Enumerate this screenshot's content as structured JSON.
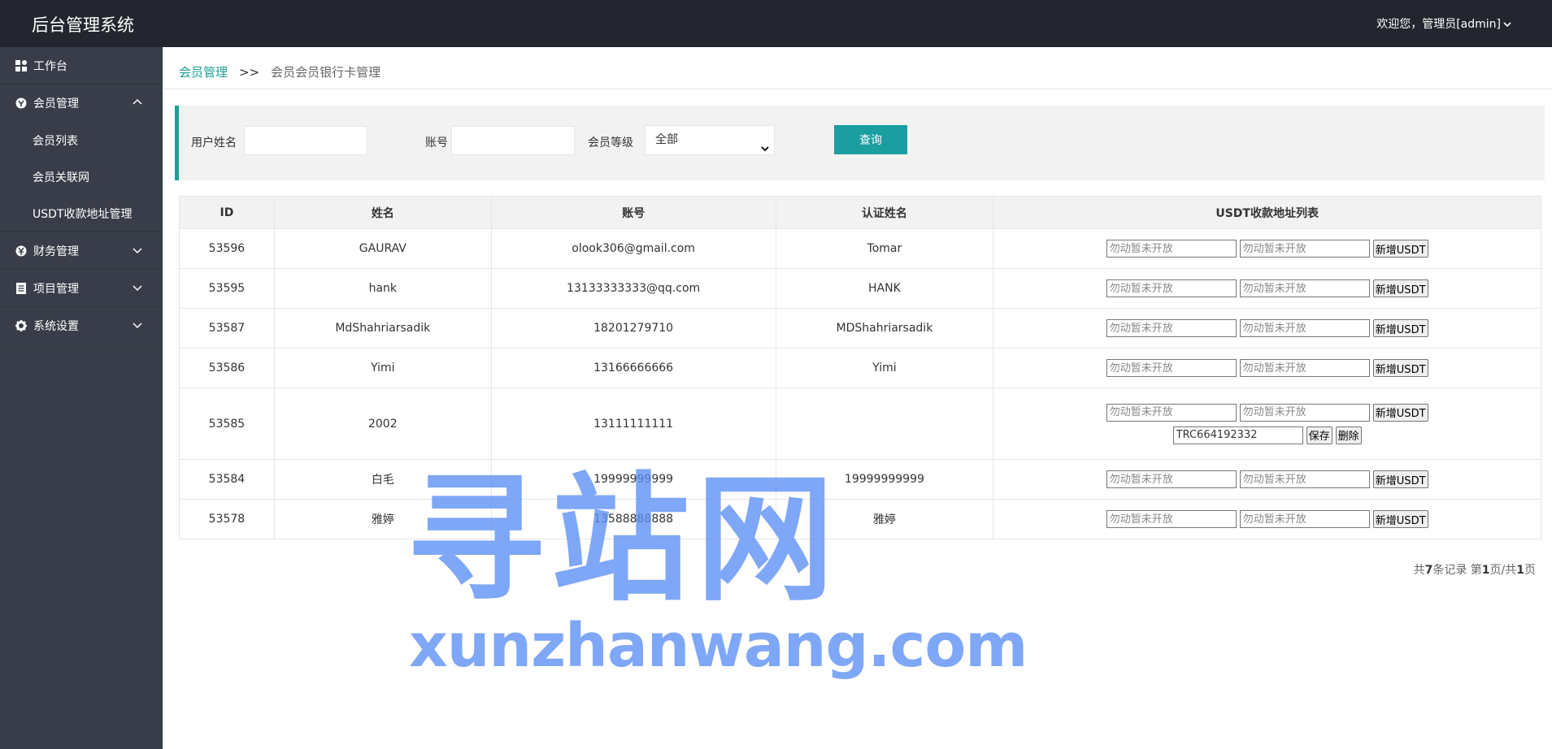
{
  "header": {
    "title": "后台管理系统",
    "user_menu": "欢迎您，管理员[admin]"
  },
  "sidebar": {
    "items": [
      {
        "label": "工作台",
        "icon": "dashboard-icon"
      },
      {
        "label": "会员管理",
        "icon": "member-icon",
        "expanded": true,
        "children": [
          {
            "label": "会员列表"
          },
          {
            "label": "会员关联网"
          },
          {
            "label": "USDT收款地址管理"
          }
        ]
      },
      {
        "label": "财务管理",
        "icon": "finance-icon"
      },
      {
        "label": "项目管理",
        "icon": "project-icon"
      },
      {
        "label": "系统设置",
        "icon": "gear-icon"
      }
    ]
  },
  "breadcrumb": {
    "parent": "会员管理",
    "separator": ">>",
    "current": "会员会员银行卡管理"
  },
  "search": {
    "username_label": "用户姓名",
    "username_value": "",
    "account_label": "账号",
    "account_value": "",
    "level_label": "会员等级",
    "level_value": "全部",
    "query_button": "查询"
  },
  "table": {
    "headers": [
      "ID",
      "姓名",
      "账号",
      "认证姓名",
      "USDT收款地址列表"
    ],
    "rows": [
      {
        "id": "53596",
        "name": "GAURAV",
        "account": "olook306@gmail.com",
        "real_name": "Tomar"
      },
      {
        "id": "53595",
        "name": "hank",
        "account": "13133333333@qq.com",
        "real_name": "HANK"
      },
      {
        "id": "53587",
        "name": "MdShahriarsadik",
        "account": "18201279710",
        "real_name": "MDShahriarsadik"
      },
      {
        "id": "53586",
        "name": "Yimi",
        "account": "13166666666",
        "real_name": "Yimi"
      },
      {
        "id": "53585",
        "name": "2002",
        "account": "13111111111",
        "real_name": "",
        "saved_address": "TRC664192332"
      },
      {
        "id": "53584",
        "name": "白毛",
        "account": "19999999999",
        "real_name": "19999999999"
      },
      {
        "id": "53578",
        "name": "雅婷",
        "account": "13588888888",
        "real_name": "雅婷"
      }
    ],
    "usdt_placeholder": "勿动暂未开放",
    "add_button": "新增USDT",
    "save_button": "保存",
    "delete_button": "删除"
  },
  "pager": {
    "prefix": "共",
    "total": "7",
    "records_text": "条记录 第",
    "page": "1",
    "middle": "页/共",
    "pages": "1",
    "suffix": "页"
  },
  "watermark": {
    "cn": "寻站网",
    "en": "xunzhanwang.com"
  },
  "colors": {
    "topbar": "#23262e",
    "sidebar": "#393d49",
    "accent": "#1aa094",
    "query_button": "#1a9ea0",
    "watermark": "#5c8ff5"
  }
}
